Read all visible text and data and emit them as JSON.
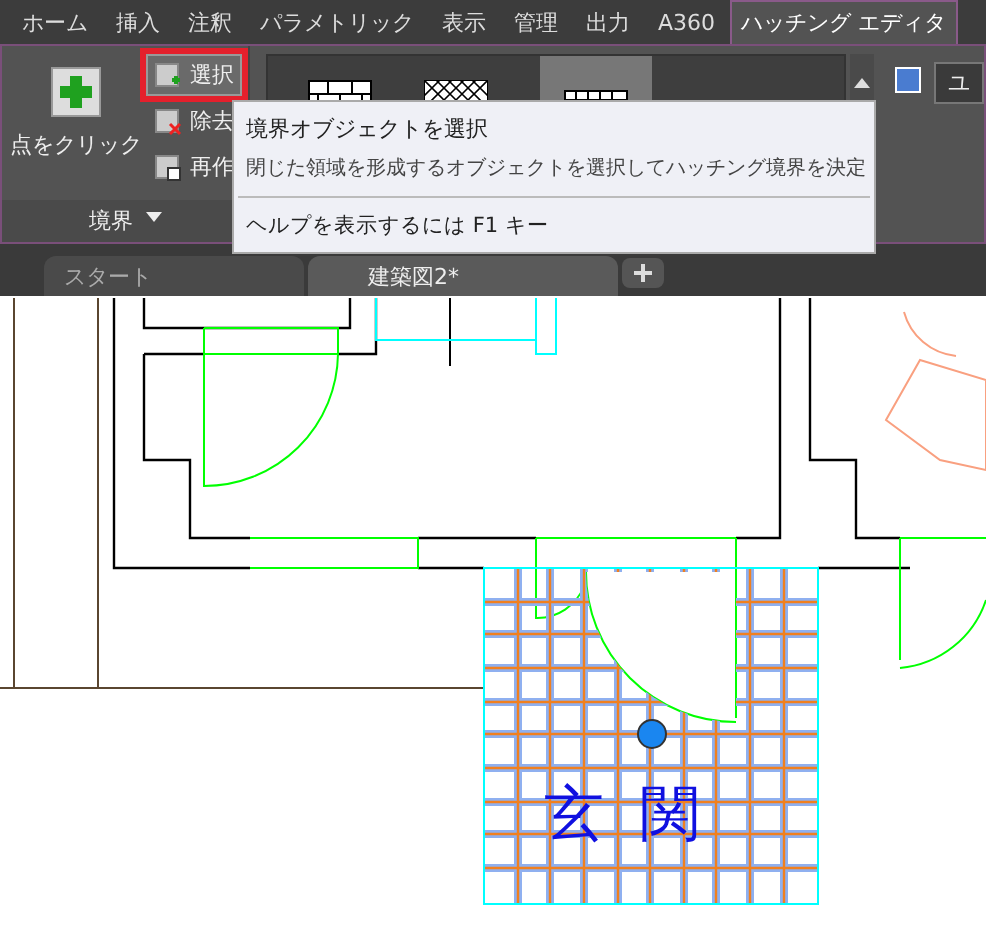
{
  "menu_tabs": [
    {
      "label": "ホーム",
      "selected": false
    },
    {
      "label": "挿入",
      "selected": false
    },
    {
      "label": "注釈",
      "selected": false
    },
    {
      "label": "パラメトリック",
      "selected": false
    },
    {
      "label": "表示",
      "selected": false
    },
    {
      "label": "管理",
      "selected": false
    },
    {
      "label": "出力",
      "selected": false
    },
    {
      "label": "A360",
      "selected": false
    },
    {
      "label": "ハッチング エディタ",
      "selected": true
    }
  ],
  "ribbon": {
    "pick_points": "点をクリック",
    "select": {
      "label": "選択",
      "highlighted": true
    },
    "remove": "除去",
    "recreate": "再作",
    "panel_title": "境界",
    "right_label": "ユ"
  },
  "tooltip": {
    "title": "境界オブジェクトを選択",
    "description": "閉じた領域を形成するオブジェクトを選択してハッチング境界を決定",
    "help": "ヘルプを表示するには F1 キー"
  },
  "doc_tabs": [
    {
      "label": "スタート",
      "selected": false
    },
    {
      "label": "建築図2*",
      "selected": true
    }
  ],
  "drawing": {
    "room_label": "玄関"
  }
}
